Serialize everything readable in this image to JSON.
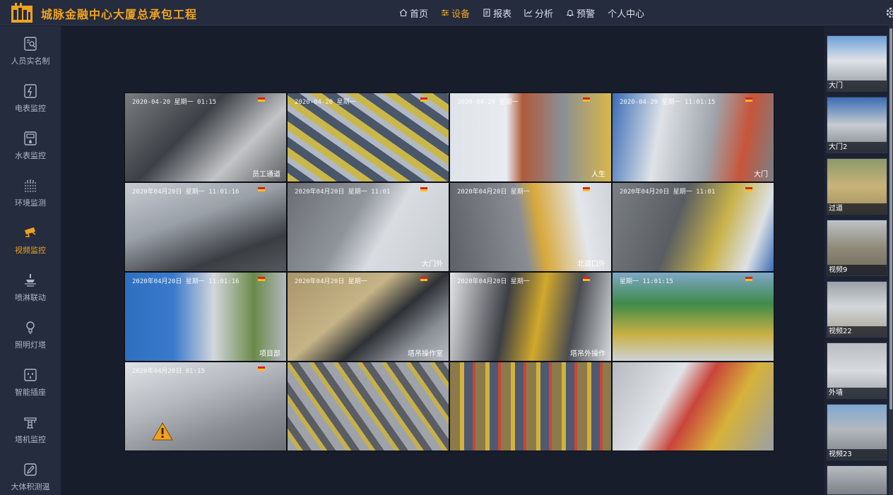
{
  "app": {
    "title": "城脉金融中心大厦总承包工程",
    "brand_color": "#f0a21f"
  },
  "nav": {
    "items": [
      {
        "label": "首页",
        "icon": "home-icon",
        "active": false
      },
      {
        "label": "设备",
        "icon": "sliders-icon",
        "active": true
      },
      {
        "label": "报表",
        "icon": "report-icon",
        "active": false
      },
      {
        "label": "分析",
        "icon": "chart-icon",
        "active": false
      },
      {
        "label": "预警",
        "icon": "bell-icon",
        "active": false
      },
      {
        "label": "个人中心",
        "icon": "",
        "active": false
      }
    ]
  },
  "sidebar": {
    "items": [
      {
        "label": "人员实名制",
        "icon": "id-card-icon",
        "active": false
      },
      {
        "label": "电表监控",
        "icon": "electric-meter-icon",
        "active": false
      },
      {
        "label": "水表监控",
        "icon": "water-meter-icon",
        "active": false
      },
      {
        "label": "环境监测",
        "icon": "environment-icon",
        "active": false
      },
      {
        "label": "视频监控",
        "icon": "camera-icon",
        "active": true
      },
      {
        "label": "喷淋联动",
        "icon": "sprinkler-icon",
        "active": false
      },
      {
        "label": "照明灯塔",
        "icon": "light-tower-icon",
        "active": false
      },
      {
        "label": "智能插座",
        "icon": "socket-icon",
        "active": false
      },
      {
        "label": "塔机监控",
        "icon": "tower-crane-icon",
        "active": false
      },
      {
        "label": "大体积测温",
        "icon": "thermometer-icon",
        "active": false
      }
    ]
  },
  "video_wall": {
    "cells": [
      {
        "ts": "2020-04-20 星期一 01:15",
        "caption": "员工通道"
      },
      {
        "ts": "2020-04-20 星期一",
        "caption": ""
      },
      {
        "ts": "2020-04-20 星期一",
        "caption": "人生"
      },
      {
        "ts": "2020-04-20 星期一 11:01:15",
        "caption": "大门"
      },
      {
        "ts": "2020年04月20日 星期一 11:01:16",
        "caption": ""
      },
      {
        "ts": "2020年04月20日 星期一 11:01",
        "caption": "大门外"
      },
      {
        "ts": "2020年04月20日 星期一",
        "caption": "北道口外"
      },
      {
        "ts": "2020年04月20日 星期一 11:01",
        "caption": ""
      },
      {
        "ts": "2020年04月20日 星期一 11:01:16",
        "caption": "项目部"
      },
      {
        "ts": "2020年04月20日 星期一",
        "caption": "塔吊操作室"
      },
      {
        "ts": "2020年04月20日 星期一",
        "caption": "塔吊外操作"
      },
      {
        "ts": "星期一 11:01:15",
        "caption": ""
      },
      {
        "ts": "2020年04月20日 01:15",
        "caption": ""
      },
      {
        "ts": "",
        "caption": ""
      },
      {
        "ts": "",
        "caption": ""
      },
      {
        "ts": "",
        "caption": ""
      }
    ]
  },
  "thumbnails": {
    "items": [
      {
        "label": "大门"
      },
      {
        "label": "大门2"
      },
      {
        "label": "过道"
      },
      {
        "label": "视频9"
      },
      {
        "label": "视频22"
      },
      {
        "label": "外墙"
      },
      {
        "label": "视频23"
      },
      {
        "label": ""
      }
    ]
  }
}
